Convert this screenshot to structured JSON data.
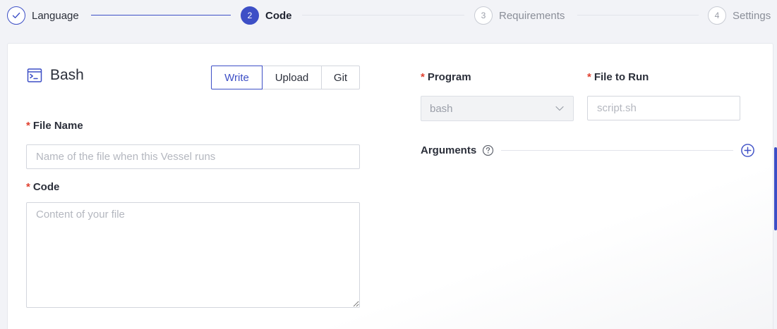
{
  "steps": [
    {
      "label": "Language",
      "number": "1",
      "state": "done"
    },
    {
      "label": "Code",
      "number": "2",
      "state": "active"
    },
    {
      "label": "Requirements",
      "number": "3",
      "state": "wait"
    },
    {
      "label": "Settings",
      "number": "4",
      "state": "wait"
    }
  ],
  "language": {
    "name": "Bash",
    "icon": "terminal-icon"
  },
  "source_tabs": [
    {
      "label": "Write",
      "active": true
    },
    {
      "label": "Upload",
      "active": false
    },
    {
      "label": "Git",
      "active": false
    }
  ],
  "form": {
    "required_mark": "*",
    "file_name": {
      "label": "File Name",
      "placeholder": "Name of the file when this Vessel runs",
      "value": ""
    },
    "code": {
      "label": "Code",
      "placeholder": "Content of your file",
      "value": ""
    },
    "program": {
      "label": "Program",
      "value": "bash",
      "disabled": true
    },
    "file_to_run": {
      "label": "File to Run",
      "placeholder": "script.sh",
      "value": ""
    },
    "arguments": {
      "label": "Arguments",
      "help_icon": "question-circle-icon",
      "add_icon": "plus-circle-icon"
    }
  },
  "colors": {
    "primary": "#3d4fc6",
    "required": "#e0402f",
    "background": "#f2f3f7",
    "border": "#d3d6dd"
  }
}
